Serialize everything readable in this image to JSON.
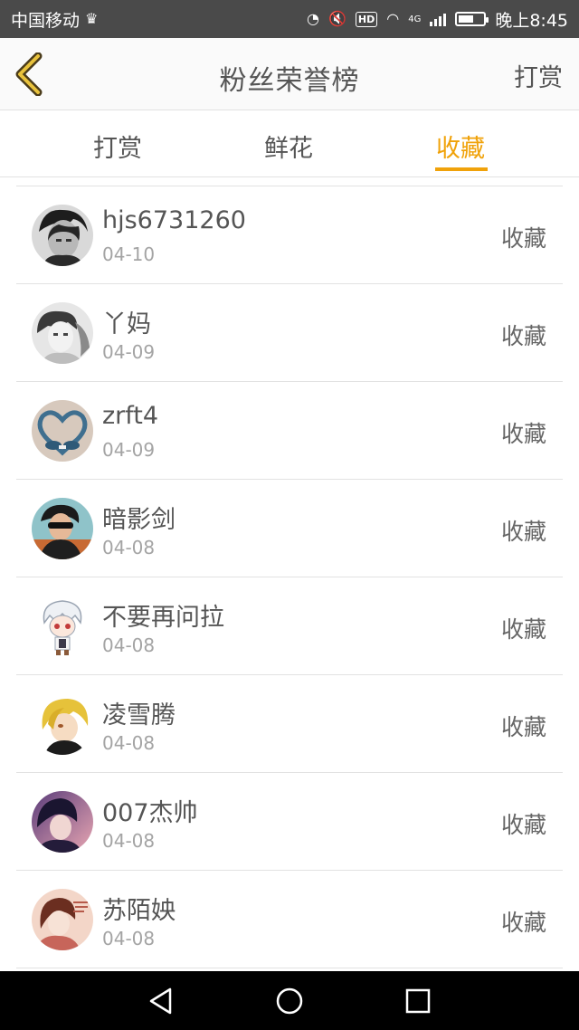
{
  "status_bar": {
    "carrier": "中国移动",
    "time": "晚上8:45",
    "network": "4G",
    "hd": "HD",
    "battery_level": 0.6
  },
  "header": {
    "title": "粉丝荣誉榜",
    "right_action": "打赏",
    "back_icon": "chevron-left-icon",
    "accent_color": "#f0a20a"
  },
  "tabs": [
    {
      "label": "打赏",
      "active": false
    },
    {
      "label": "鲜花",
      "active": false
    },
    {
      "label": "收藏",
      "active": true
    }
  ],
  "list": [
    {
      "name": "hjs6731260",
      "date": "04-10",
      "action": "收藏"
    },
    {
      "name": "丫妈",
      "date": "04-09",
      "action": "收藏"
    },
    {
      "name": "zrft4",
      "date": "04-09",
      "action": "收藏"
    },
    {
      "name": "暗影剑",
      "date": "04-08",
      "action": "收藏"
    },
    {
      "name": "不要再问拉",
      "date": "04-08",
      "action": "收藏"
    },
    {
      "name": "凌雪腾",
      "date": "04-08",
      "action": "收藏"
    },
    {
      "name": "007杰帅",
      "date": "04-08",
      "action": "收藏"
    },
    {
      "name": "苏陌姎",
      "date": "04-08",
      "action": "收藏"
    }
  ]
}
